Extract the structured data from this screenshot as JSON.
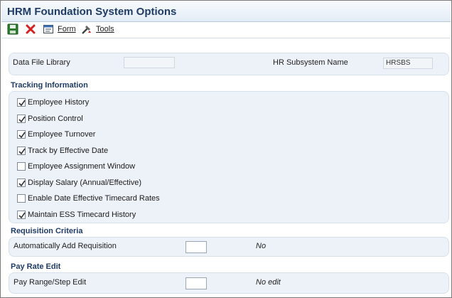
{
  "window": {
    "title": "HRM Foundation System Options"
  },
  "toolbar": {
    "save_icon": "save-icon",
    "close_icon": "close-icon",
    "form_label": "Form",
    "tools_label": "Tools"
  },
  "header_fields": {
    "data_file_library_label": "Data File Library",
    "data_file_library_value": "",
    "hr_subsystem_name_label": "HR Subsystem Name",
    "hr_subsystem_name_value": "HRSBS"
  },
  "tracking": {
    "heading": "Tracking Information",
    "items": [
      {
        "label": "Employee History",
        "checked": true
      },
      {
        "label": "Position Control",
        "checked": true
      },
      {
        "label": "Employee Turnover",
        "checked": true
      },
      {
        "label": "Track by Effective Date",
        "checked": true
      },
      {
        "label": "Employee Assignment Window",
        "checked": false
      },
      {
        "label": "Display Salary (Annual/Effective)",
        "checked": true
      },
      {
        "label": "Enable Date Effective Timecard Rates",
        "checked": false
      },
      {
        "label": "Maintain ESS Timecard History",
        "checked": true
      }
    ]
  },
  "requisition": {
    "heading": "Requisition Criteria",
    "label": "Automatically Add Requisition",
    "value": "",
    "description": "No"
  },
  "pay_rate": {
    "heading": "Pay Rate Edit",
    "label": "Pay Range/Step Edit",
    "value": "",
    "description": "No edit"
  }
}
